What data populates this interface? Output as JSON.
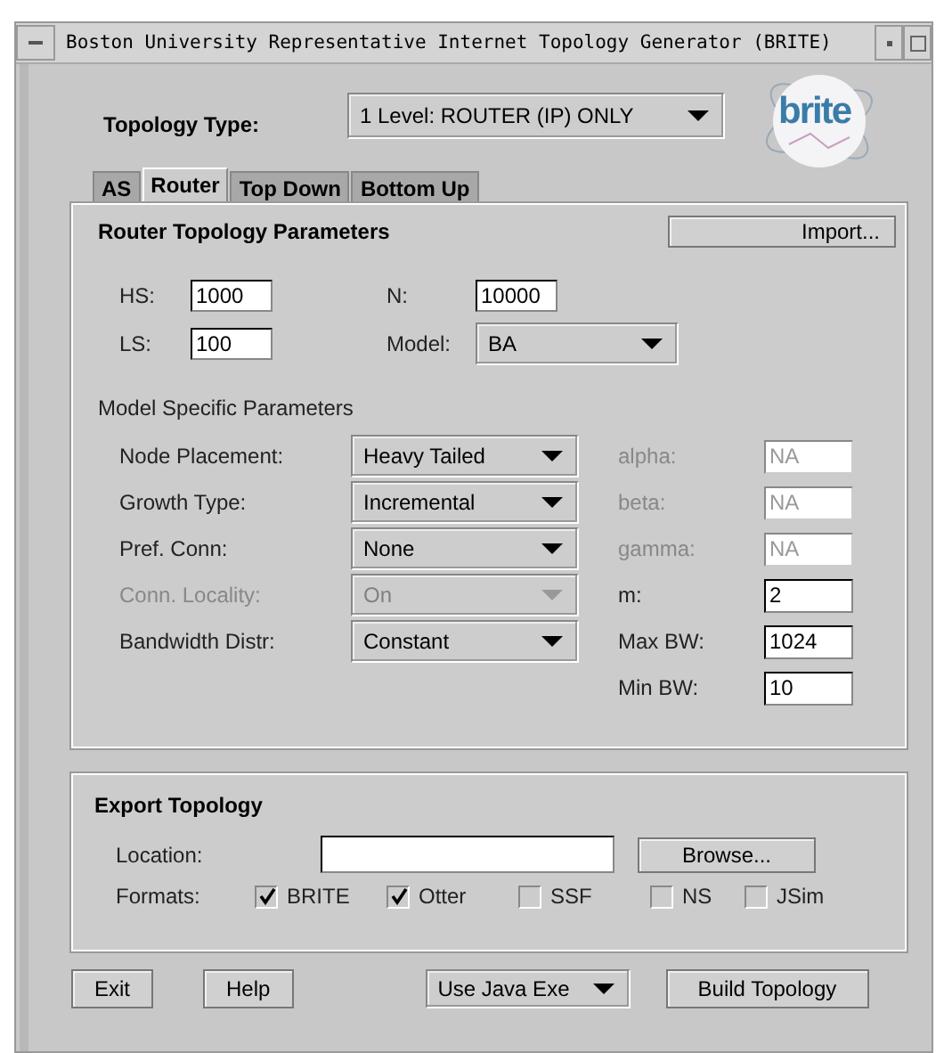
{
  "window": {
    "title": "Boston University Representative Internet Topology Generator (BRITE)"
  },
  "topology_type": {
    "label": "Topology Type:",
    "value": "1 Level: ROUTER (IP) ONLY"
  },
  "logo": {
    "text": "brite"
  },
  "tabs": [
    {
      "label": "AS",
      "selected": false
    },
    {
      "label": "Router",
      "selected": true
    },
    {
      "label": "Top Down",
      "selected": false
    },
    {
      "label": "Bottom Up",
      "selected": false
    }
  ],
  "router_panel": {
    "title": "Router Topology Parameters",
    "import_button": "Import...",
    "basic_params": [
      {
        "kind": "text",
        "label": "HS:",
        "value": "1000"
      },
      {
        "kind": "text",
        "label": "N:",
        "value": "10000"
      },
      {
        "kind": "text",
        "label": "LS:",
        "value": "100"
      },
      {
        "kind": "select",
        "label": "Model:",
        "value": "BA"
      }
    ],
    "model_specific": {
      "title": "Model Specific Parameters",
      "rows": [
        {
          "label": "Node Placement:",
          "value": "Heavy Tailed",
          "disabled": false,
          "param": {
            "label": "alpha:",
            "value": "NA",
            "disabled": true
          }
        },
        {
          "label": "Growth Type:",
          "value": "Incremental",
          "disabled": false,
          "param": {
            "label": "beta:",
            "value": "NA",
            "disabled": true
          }
        },
        {
          "label": "Pref. Conn:",
          "value": "None",
          "disabled": false,
          "param": {
            "label": "gamma:",
            "value": "NA",
            "disabled": true
          }
        },
        {
          "label": "Conn. Locality:",
          "value": "On",
          "disabled": true,
          "param": {
            "label": "m:",
            "value": "2",
            "disabled": false
          }
        },
        {
          "label": "Bandwidth Distr:",
          "value": "Constant",
          "disabled": false,
          "param": {
            "label": "Max BW:",
            "value": "1024",
            "disabled": false
          }
        },
        {
          "param": {
            "label": "Min BW:",
            "value": "10",
            "disabled": false
          }
        }
      ]
    }
  },
  "export_panel": {
    "title": "Export Topology",
    "location_label": "Location:",
    "browse_button": "Browse...",
    "formats_label": "Formats:",
    "formats": [
      {
        "label": "BRITE",
        "checked": true
      },
      {
        "label": "Otter",
        "checked": true
      },
      {
        "label": "SSF",
        "checked": false
      },
      {
        "label": "NS",
        "checked": false
      },
      {
        "label": "JSim",
        "checked": false
      }
    ]
  },
  "bottom": {
    "exit_button": "Exit",
    "help_button": "Help",
    "executable": "Use Java Exe",
    "build_button": "Build Topology"
  }
}
